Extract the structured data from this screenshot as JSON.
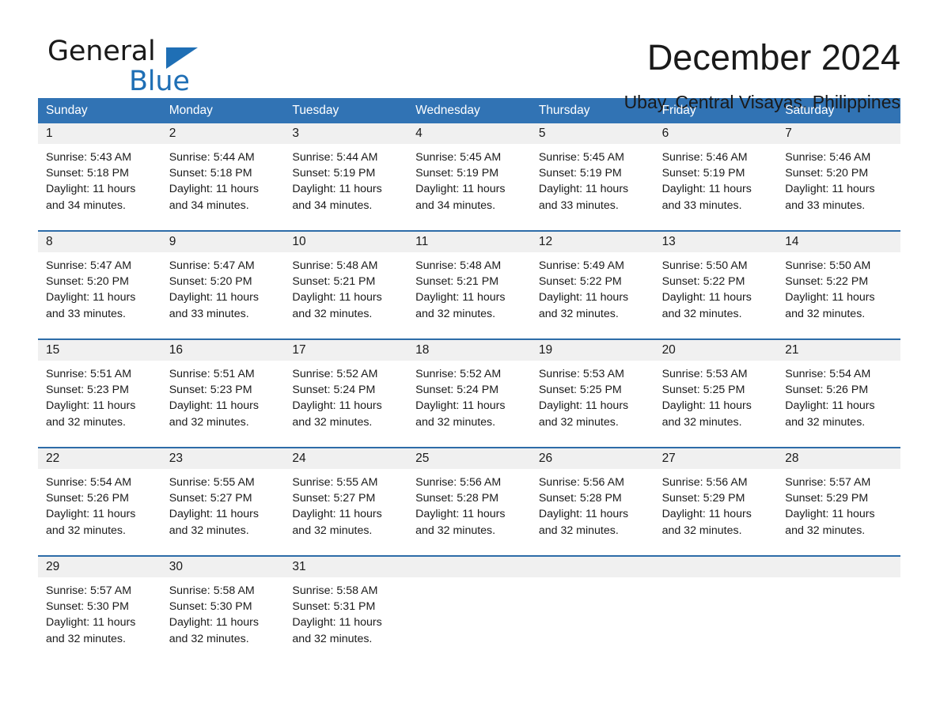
{
  "brand": {
    "name_part1": "General",
    "name_part2": "Blue",
    "triangle_color": "#1f6fb5"
  },
  "header": {
    "title": "December 2024",
    "subtitle": "Ubay, Central Visayas, Philippines"
  },
  "colors": {
    "header_blue": "#3173b4",
    "row_divider_blue": "#2d6ca8",
    "daynum_band_gray": "#f0f0f0",
    "text": "#1a1a1a"
  },
  "weekdays": [
    "Sunday",
    "Monday",
    "Tuesday",
    "Wednesday",
    "Thursday",
    "Friday",
    "Saturday"
  ],
  "labels": {
    "sunrise_prefix": "Sunrise: ",
    "sunset_prefix": "Sunset: ",
    "daylight_prefix": "Daylight: "
  },
  "weeks": [
    {
      "days": [
        {
          "date": "1",
          "sunrise": "Sunrise: 5:43 AM",
          "sunset": "Sunset: 5:18 PM",
          "daylight": "Daylight: 11 hours and 34 minutes."
        },
        {
          "date": "2",
          "sunrise": "Sunrise: 5:44 AM",
          "sunset": "Sunset: 5:18 PM",
          "daylight": "Daylight: 11 hours and 34 minutes."
        },
        {
          "date": "3",
          "sunrise": "Sunrise: 5:44 AM",
          "sunset": "Sunset: 5:19 PM",
          "daylight": "Daylight: 11 hours and 34 minutes."
        },
        {
          "date": "4",
          "sunrise": "Sunrise: 5:45 AM",
          "sunset": "Sunset: 5:19 PM",
          "daylight": "Daylight: 11 hours and 34 minutes."
        },
        {
          "date": "5",
          "sunrise": "Sunrise: 5:45 AM",
          "sunset": "Sunset: 5:19 PM",
          "daylight": "Daylight: 11 hours and 33 minutes."
        },
        {
          "date": "6",
          "sunrise": "Sunrise: 5:46 AM",
          "sunset": "Sunset: 5:19 PM",
          "daylight": "Daylight: 11 hours and 33 minutes."
        },
        {
          "date": "7",
          "sunrise": "Sunrise: 5:46 AM",
          "sunset": "Sunset: 5:20 PM",
          "daylight": "Daylight: 11 hours and 33 minutes."
        }
      ]
    },
    {
      "days": [
        {
          "date": "8",
          "sunrise": "Sunrise: 5:47 AM",
          "sunset": "Sunset: 5:20 PM",
          "daylight": "Daylight: 11 hours and 33 minutes."
        },
        {
          "date": "9",
          "sunrise": "Sunrise: 5:47 AM",
          "sunset": "Sunset: 5:20 PM",
          "daylight": "Daylight: 11 hours and 33 minutes."
        },
        {
          "date": "10",
          "sunrise": "Sunrise: 5:48 AM",
          "sunset": "Sunset: 5:21 PM",
          "daylight": "Daylight: 11 hours and 32 minutes."
        },
        {
          "date": "11",
          "sunrise": "Sunrise: 5:48 AM",
          "sunset": "Sunset: 5:21 PM",
          "daylight": "Daylight: 11 hours and 32 minutes."
        },
        {
          "date": "12",
          "sunrise": "Sunrise: 5:49 AM",
          "sunset": "Sunset: 5:22 PM",
          "daylight": "Daylight: 11 hours and 32 minutes."
        },
        {
          "date": "13",
          "sunrise": "Sunrise: 5:50 AM",
          "sunset": "Sunset: 5:22 PM",
          "daylight": "Daylight: 11 hours and 32 minutes."
        },
        {
          "date": "14",
          "sunrise": "Sunrise: 5:50 AM",
          "sunset": "Sunset: 5:22 PM",
          "daylight": "Daylight: 11 hours and 32 minutes."
        }
      ]
    },
    {
      "days": [
        {
          "date": "15",
          "sunrise": "Sunrise: 5:51 AM",
          "sunset": "Sunset: 5:23 PM",
          "daylight": "Daylight: 11 hours and 32 minutes."
        },
        {
          "date": "16",
          "sunrise": "Sunrise: 5:51 AM",
          "sunset": "Sunset: 5:23 PM",
          "daylight": "Daylight: 11 hours and 32 minutes."
        },
        {
          "date": "17",
          "sunrise": "Sunrise: 5:52 AM",
          "sunset": "Sunset: 5:24 PM",
          "daylight": "Daylight: 11 hours and 32 minutes."
        },
        {
          "date": "18",
          "sunrise": "Sunrise: 5:52 AM",
          "sunset": "Sunset: 5:24 PM",
          "daylight": "Daylight: 11 hours and 32 minutes."
        },
        {
          "date": "19",
          "sunrise": "Sunrise: 5:53 AM",
          "sunset": "Sunset: 5:25 PM",
          "daylight": "Daylight: 11 hours and 32 minutes."
        },
        {
          "date": "20",
          "sunrise": "Sunrise: 5:53 AM",
          "sunset": "Sunset: 5:25 PM",
          "daylight": "Daylight: 11 hours and 32 minutes."
        },
        {
          "date": "21",
          "sunrise": "Sunrise: 5:54 AM",
          "sunset": "Sunset: 5:26 PM",
          "daylight": "Daylight: 11 hours and 32 minutes."
        }
      ]
    },
    {
      "days": [
        {
          "date": "22",
          "sunrise": "Sunrise: 5:54 AM",
          "sunset": "Sunset: 5:26 PM",
          "daylight": "Daylight: 11 hours and 32 minutes."
        },
        {
          "date": "23",
          "sunrise": "Sunrise: 5:55 AM",
          "sunset": "Sunset: 5:27 PM",
          "daylight": "Daylight: 11 hours and 32 minutes."
        },
        {
          "date": "24",
          "sunrise": "Sunrise: 5:55 AM",
          "sunset": "Sunset: 5:27 PM",
          "daylight": "Daylight: 11 hours and 32 minutes."
        },
        {
          "date": "25",
          "sunrise": "Sunrise: 5:56 AM",
          "sunset": "Sunset: 5:28 PM",
          "daylight": "Daylight: 11 hours and 32 minutes."
        },
        {
          "date": "26",
          "sunrise": "Sunrise: 5:56 AM",
          "sunset": "Sunset: 5:28 PM",
          "daylight": "Daylight: 11 hours and 32 minutes."
        },
        {
          "date": "27",
          "sunrise": "Sunrise: 5:56 AM",
          "sunset": "Sunset: 5:29 PM",
          "daylight": "Daylight: 11 hours and 32 minutes."
        },
        {
          "date": "28",
          "sunrise": "Sunrise: 5:57 AM",
          "sunset": "Sunset: 5:29 PM",
          "daylight": "Daylight: 11 hours and 32 minutes."
        }
      ]
    },
    {
      "days": [
        {
          "date": "29",
          "sunrise": "Sunrise: 5:57 AM",
          "sunset": "Sunset: 5:30 PM",
          "daylight": "Daylight: 11 hours and 32 minutes."
        },
        {
          "date": "30",
          "sunrise": "Sunrise: 5:58 AM",
          "sunset": "Sunset: 5:30 PM",
          "daylight": "Daylight: 11 hours and 32 minutes."
        },
        {
          "date": "31",
          "sunrise": "Sunrise: 5:58 AM",
          "sunset": "Sunset: 5:31 PM",
          "daylight": "Daylight: 11 hours and 32 minutes."
        },
        {
          "date": "",
          "sunrise": "",
          "sunset": "",
          "daylight": ""
        },
        {
          "date": "",
          "sunrise": "",
          "sunset": "",
          "daylight": ""
        },
        {
          "date": "",
          "sunrise": "",
          "sunset": "",
          "daylight": ""
        },
        {
          "date": "",
          "sunrise": "",
          "sunset": "",
          "daylight": ""
        }
      ]
    }
  ]
}
